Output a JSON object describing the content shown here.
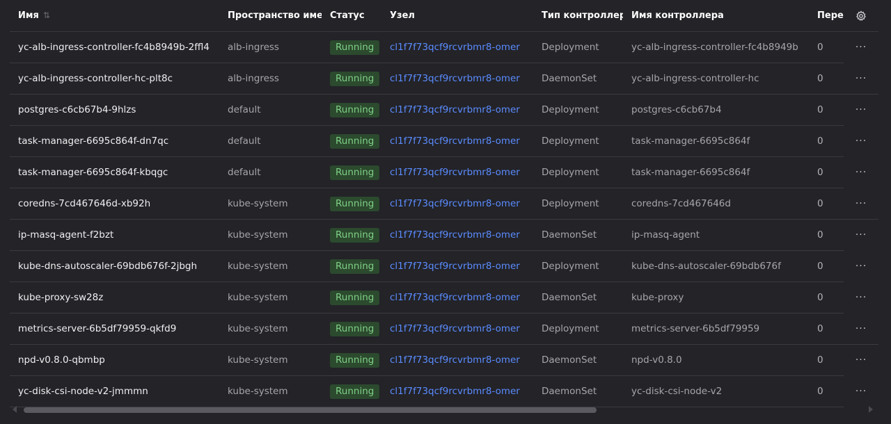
{
  "columns": {
    "name": "Имя",
    "namespace": "Пространство имен",
    "status": "Статус",
    "node": "Узел",
    "controller_type": "Тип контроллера",
    "controller_name": "Имя контроллера",
    "restarts": "Пере:"
  },
  "rows": [
    {
      "name": "yc-alb-ingress-controller-fc4b8949b-2ffl4",
      "namespace": "alb-ingress",
      "status": "Running",
      "node": "cl1f7f73qcf9rcvrbmr8-omer",
      "controller_type": "Deployment",
      "controller_name": "yc-alb-ingress-controller-fc4b8949b",
      "restarts": "0"
    },
    {
      "name": "yc-alb-ingress-controller-hc-plt8c",
      "namespace": "alb-ingress",
      "status": "Running",
      "node": "cl1f7f73qcf9rcvrbmr8-omer",
      "controller_type": "DaemonSet",
      "controller_name": "yc-alb-ingress-controller-hc",
      "restarts": "0"
    },
    {
      "name": "postgres-c6cb67b4-9hlzs",
      "namespace": "default",
      "status": "Running",
      "node": "cl1f7f73qcf9rcvrbmr8-omer",
      "controller_type": "Deployment",
      "controller_name": "postgres-c6cb67b4",
      "restarts": "0"
    },
    {
      "name": "task-manager-6695c864f-dn7qc",
      "namespace": "default",
      "status": "Running",
      "node": "cl1f7f73qcf9rcvrbmr8-omer",
      "controller_type": "Deployment",
      "controller_name": "task-manager-6695c864f",
      "restarts": "0"
    },
    {
      "name": "task-manager-6695c864f-kbqgc",
      "namespace": "default",
      "status": "Running",
      "node": "cl1f7f73qcf9rcvrbmr8-omer",
      "controller_type": "Deployment",
      "controller_name": "task-manager-6695c864f",
      "restarts": "0"
    },
    {
      "name": "coredns-7cd467646d-xb92h",
      "namespace": "kube-system",
      "status": "Running",
      "node": "cl1f7f73qcf9rcvrbmr8-omer",
      "controller_type": "Deployment",
      "controller_name": "coredns-7cd467646d",
      "restarts": "0"
    },
    {
      "name": "ip-masq-agent-f2bzt",
      "namespace": "kube-system",
      "status": "Running",
      "node": "cl1f7f73qcf9rcvrbmr8-omer",
      "controller_type": "DaemonSet",
      "controller_name": "ip-masq-agent",
      "restarts": "0"
    },
    {
      "name": "kube-dns-autoscaler-69bdb676f-2jbgh",
      "namespace": "kube-system",
      "status": "Running",
      "node": "cl1f7f73qcf9rcvrbmr8-omer",
      "controller_type": "Deployment",
      "controller_name": "kube-dns-autoscaler-69bdb676f",
      "restarts": "0"
    },
    {
      "name": "kube-proxy-sw28z",
      "namespace": "kube-system",
      "status": "Running",
      "node": "cl1f7f73qcf9rcvrbmr8-omer",
      "controller_type": "DaemonSet",
      "controller_name": "kube-proxy",
      "restarts": "0"
    },
    {
      "name": "metrics-server-6b5df79959-qkfd9",
      "namespace": "kube-system",
      "status": "Running",
      "node": "cl1f7f73qcf9rcvrbmr8-omer",
      "controller_type": "Deployment",
      "controller_name": "metrics-server-6b5df79959",
      "restarts": "0"
    },
    {
      "name": "npd-v0.8.0-qbmbp",
      "namespace": "kube-system",
      "status": "Running",
      "node": "cl1f7f73qcf9rcvrbmr8-omer",
      "controller_type": "DaemonSet",
      "controller_name": "npd-v0.8.0",
      "restarts": "0"
    },
    {
      "name": "yc-disk-csi-node-v2-jmmmn",
      "namespace": "kube-system",
      "status": "Running",
      "node": "cl1f7f73qcf9rcvrbmr8-omer",
      "controller_type": "DaemonSet",
      "controller_name": "yc-disk-csi-node-v2",
      "restarts": "0"
    }
  ],
  "row_action_label": "···",
  "icons": {
    "sort": "sort-arrows-icon",
    "settings": "gear-icon",
    "row_menu": "more-horizontal-icon",
    "scroll_left": "scroll-left-arrow-icon",
    "scroll_right": "scroll-right-arrow-icon"
  },
  "colors": {
    "background": "#232328",
    "status_bg": "#2c4a2e",
    "status_text": "#7fd187",
    "link": "#5b8cff"
  },
  "scroll": {
    "horizontal_fraction_visible": 0.68
  }
}
